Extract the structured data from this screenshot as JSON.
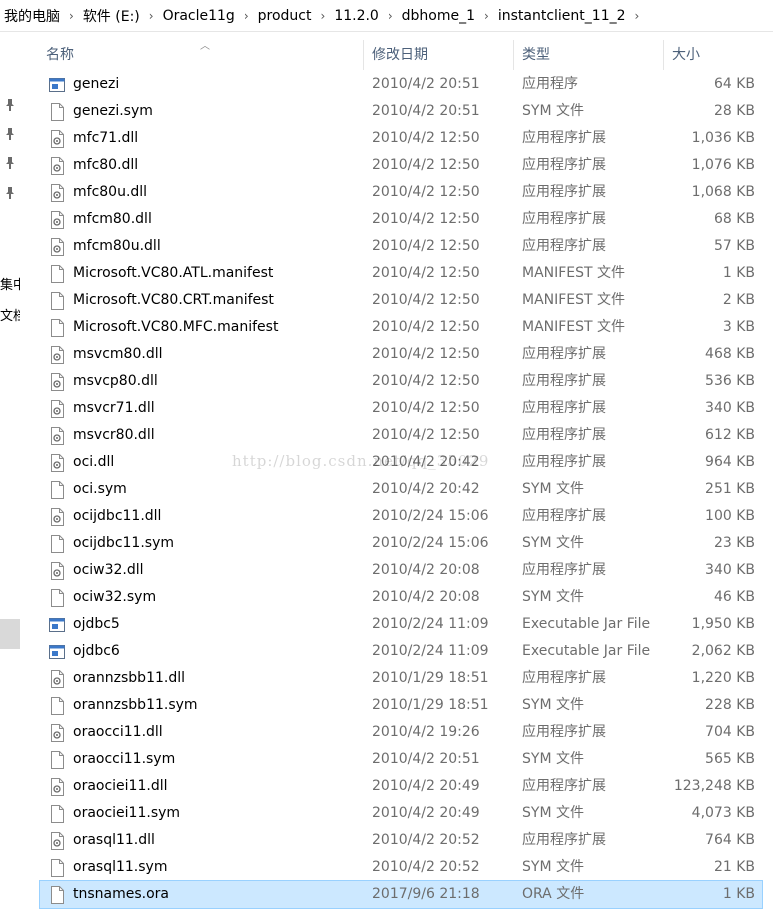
{
  "breadcrumb": [
    "我的电脑",
    "软件 (E:)",
    "Oracle11g",
    "product",
    "11.2.0",
    "dbhome_1",
    "instantclient_11_2"
  ],
  "left_pane": {
    "labels": [
      "集中",
      "文档"
    ]
  },
  "columns": {
    "name": "名称",
    "date": "修改日期",
    "type": "类型",
    "size": "大小"
  },
  "files": [
    {
      "name": "genezi",
      "date": "2010/4/2 20:51",
      "type": "应用程序",
      "size": "64 KB",
      "icon": "application-icon"
    },
    {
      "name": "genezi.sym",
      "date": "2010/4/2 20:51",
      "type": "SYM 文件",
      "size": "28 KB",
      "icon": "file-icon"
    },
    {
      "name": "mfc71.dll",
      "date": "2010/4/2 12:50",
      "type": "应用程序扩展",
      "size": "1,036 KB",
      "icon": "dll-icon"
    },
    {
      "name": "mfc80.dll",
      "date": "2010/4/2 12:50",
      "type": "应用程序扩展",
      "size": "1,076 KB",
      "icon": "dll-icon"
    },
    {
      "name": "mfc80u.dll",
      "date": "2010/4/2 12:50",
      "type": "应用程序扩展",
      "size": "1,068 KB",
      "icon": "dll-icon"
    },
    {
      "name": "mfcm80.dll",
      "date": "2010/4/2 12:50",
      "type": "应用程序扩展",
      "size": "68 KB",
      "icon": "dll-icon"
    },
    {
      "name": "mfcm80u.dll",
      "date": "2010/4/2 12:50",
      "type": "应用程序扩展",
      "size": "57 KB",
      "icon": "dll-icon"
    },
    {
      "name": "Microsoft.VC80.ATL.manifest",
      "date": "2010/4/2 12:50",
      "type": "MANIFEST 文件",
      "size": "1 KB",
      "icon": "file-icon"
    },
    {
      "name": "Microsoft.VC80.CRT.manifest",
      "date": "2010/4/2 12:50",
      "type": "MANIFEST 文件",
      "size": "2 KB",
      "icon": "file-icon"
    },
    {
      "name": "Microsoft.VC80.MFC.manifest",
      "date": "2010/4/2 12:50",
      "type": "MANIFEST 文件",
      "size": "3 KB",
      "icon": "file-icon"
    },
    {
      "name": "msvcm80.dll",
      "date": "2010/4/2 12:50",
      "type": "应用程序扩展",
      "size": "468 KB",
      "icon": "dll-icon"
    },
    {
      "name": "msvcp80.dll",
      "date": "2010/4/2 12:50",
      "type": "应用程序扩展",
      "size": "536 KB",
      "icon": "dll-icon"
    },
    {
      "name": "msvcr71.dll",
      "date": "2010/4/2 12:50",
      "type": "应用程序扩展",
      "size": "340 KB",
      "icon": "dll-icon"
    },
    {
      "name": "msvcr80.dll",
      "date": "2010/4/2 12:50",
      "type": "应用程序扩展",
      "size": "612 KB",
      "icon": "dll-icon"
    },
    {
      "name": "oci.dll",
      "date": "2010/4/2 20:42",
      "type": "应用程序扩展",
      "size": "964 KB",
      "icon": "dll-icon"
    },
    {
      "name": "oci.sym",
      "date": "2010/4/2 20:42",
      "type": "SYM 文件",
      "size": "251 KB",
      "icon": "file-icon"
    },
    {
      "name": "ocijdbc11.dll",
      "date": "2010/2/24 15:06",
      "type": "应用程序扩展",
      "size": "100 KB",
      "icon": "dll-icon"
    },
    {
      "name": "ocijdbc11.sym",
      "date": "2010/2/24 15:06",
      "type": "SYM 文件",
      "size": "23 KB",
      "icon": "file-icon"
    },
    {
      "name": "ociw32.dll",
      "date": "2010/4/2 20:08",
      "type": "应用程序扩展",
      "size": "340 KB",
      "icon": "dll-icon"
    },
    {
      "name": "ociw32.sym",
      "date": "2010/4/2 20:08",
      "type": "SYM 文件",
      "size": "46 KB",
      "icon": "file-icon"
    },
    {
      "name": "ojdbc5",
      "date": "2010/2/24 11:09",
      "type": "Executable Jar File",
      "size": "1,950 KB",
      "icon": "application-icon"
    },
    {
      "name": "ojdbc6",
      "date": "2010/2/24 11:09",
      "type": "Executable Jar File",
      "size": "2,062 KB",
      "icon": "application-icon"
    },
    {
      "name": "orannzsbb11.dll",
      "date": "2010/1/29 18:51",
      "type": "应用程序扩展",
      "size": "1,220 KB",
      "icon": "dll-icon"
    },
    {
      "name": "orannzsbb11.sym",
      "date": "2010/1/29 18:51",
      "type": "SYM 文件",
      "size": "228 KB",
      "icon": "file-icon"
    },
    {
      "name": "oraocci11.dll",
      "date": "2010/4/2 19:26",
      "type": "应用程序扩展",
      "size": "704 KB",
      "icon": "dll-icon"
    },
    {
      "name": "oraocci11.sym",
      "date": "2010/4/2 20:51",
      "type": "SYM 文件",
      "size": "565 KB",
      "icon": "file-icon"
    },
    {
      "name": "oraociei11.dll",
      "date": "2010/4/2 20:49",
      "type": "应用程序扩展",
      "size": "123,248 KB",
      "icon": "dll-icon"
    },
    {
      "name": "oraociei11.sym",
      "date": "2010/4/2 20:49",
      "type": "SYM 文件",
      "size": "4,073 KB",
      "icon": "file-icon"
    },
    {
      "name": "orasql11.dll",
      "date": "2010/4/2 20:52",
      "type": "应用程序扩展",
      "size": "764 KB",
      "icon": "dll-icon"
    },
    {
      "name": "orasql11.sym",
      "date": "2010/4/2 20:52",
      "type": "SYM 文件",
      "size": "21 KB",
      "icon": "file-icon"
    },
    {
      "name": "tnsnames.ora",
      "date": "2017/9/6 21:18",
      "type": "ORA 文件",
      "size": "1 KB",
      "icon": "file-icon",
      "selected": true
    }
  ],
  "watermark": "http://blog.csdn.net/qq_35029",
  "colors": {
    "selected_bg": "#cce8ff",
    "selected_border": "#99d1ff",
    "header_text": "#4c607a",
    "secondary_text": "#6d6d6d"
  }
}
